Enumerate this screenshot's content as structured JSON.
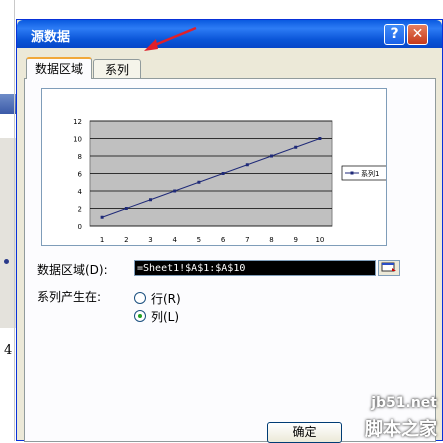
{
  "dialog": {
    "title": "源数据",
    "help_label": "?",
    "close_label": "✕"
  },
  "tabs": [
    {
      "label": "数据区域",
      "active": true
    },
    {
      "label": "系列",
      "active": false
    }
  ],
  "form": {
    "data_range_label": "数据区域(D):",
    "data_range_value": "=Sheet1!$A$1:$A$10",
    "series_in_label": "系列产生在:",
    "options": [
      {
        "label": "行(R)",
        "selected": false
      },
      {
        "label": "列(L)",
        "selected": true
      }
    ]
  },
  "buttons": {
    "ok_label": "确定"
  },
  "background": {
    "row_value": "4"
  },
  "chart_data": {
    "type": "line",
    "categories": [
      "1",
      "2",
      "3",
      "4",
      "5",
      "6",
      "7",
      "8",
      "9",
      "10"
    ],
    "series": [
      {
        "name": "系列1",
        "values": [
          1,
          2,
          3,
          4,
          5,
          6,
          7,
          8,
          9,
          10
        ]
      }
    ],
    "ylim": [
      0,
      12
    ],
    "yticks": [
      "0",
      "2",
      "4",
      "6",
      "8",
      "10",
      "12"
    ],
    "grid": true,
    "legend": "right"
  },
  "watermark": {
    "url": "jb51.net",
    "text": "脚本之家"
  },
  "colors": {
    "plot_bg": "#c0c0c0",
    "series_line": "#1f2a78",
    "arrow": "#e0202a"
  }
}
